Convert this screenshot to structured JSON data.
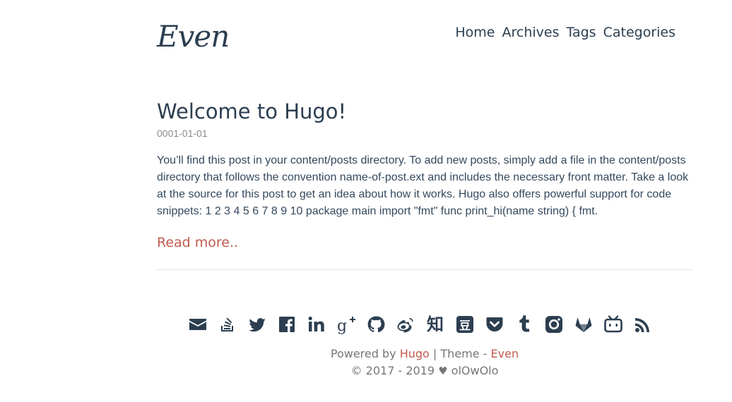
{
  "site": {
    "logo": "Even"
  },
  "nav": {
    "items": [
      "Home",
      "Archives",
      "Tags",
      "Categories"
    ]
  },
  "post": {
    "title": "Welcome to Hugo!",
    "date": "0001-01-01",
    "summary": "You’ll find this post in your content/posts directory. To add new posts, simply add a file in the content/posts directory that follows the convention name-of-post.ext and includes the necessary front matter. Take a look at the source for this post to get an idea about how it works. Hugo also offers powerful support for code snippets: 1 2 3 4 5 6 7 8 9 10 package main import \"fmt\" func print_hi(name string) { fmt.",
    "read_more": "Read more.."
  },
  "social": [
    {
      "icon": "email-icon"
    },
    {
      "icon": "stackoverflow-icon"
    },
    {
      "icon": "twitter-icon"
    },
    {
      "icon": "facebook-icon"
    },
    {
      "icon": "linkedin-icon"
    },
    {
      "icon": "google-plus-icon"
    },
    {
      "icon": "github-icon"
    },
    {
      "icon": "weibo-icon"
    },
    {
      "icon": "zhihu-icon",
      "glyph": "知"
    },
    {
      "icon": "douban-icon",
      "glyph": "豆"
    },
    {
      "icon": "pocket-icon"
    },
    {
      "icon": "tumblr-icon",
      "glyph": "t"
    },
    {
      "icon": "instagram-icon"
    },
    {
      "icon": "gitlab-icon"
    },
    {
      "icon": "bilibili-icon"
    },
    {
      "icon": "rss-icon"
    }
  ],
  "footer": {
    "powered_by": "Powered by",
    "hugo": "Hugo",
    "separator": "|",
    "theme": "Theme -",
    "even": "Even",
    "copyright": "© 2017 - 2019",
    "author": "olOwOlo"
  },
  "colors": {
    "text": "#2c3e50",
    "accent": "#c05b4d",
    "muted": "#777777"
  }
}
